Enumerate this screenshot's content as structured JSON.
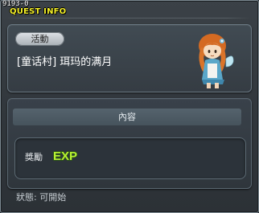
{
  "window": {
    "id_label": "9193-0",
    "title": "QUEST INFO"
  },
  "quest": {
    "category": "活動",
    "name": "[童话村] 珥玛的满月",
    "npc_icon": "npc-girl-portrait-icon"
  },
  "content": {
    "header": "內容",
    "reward_label": "獎勵",
    "reward_icon": "exp-icon",
    "reward_icon_text": "EXP"
  },
  "status": {
    "text": "狀態: 可開始"
  },
  "colors": {
    "title": "#f3ef28",
    "exp_fill": "#b8f034",
    "panel_border": "#687680"
  }
}
